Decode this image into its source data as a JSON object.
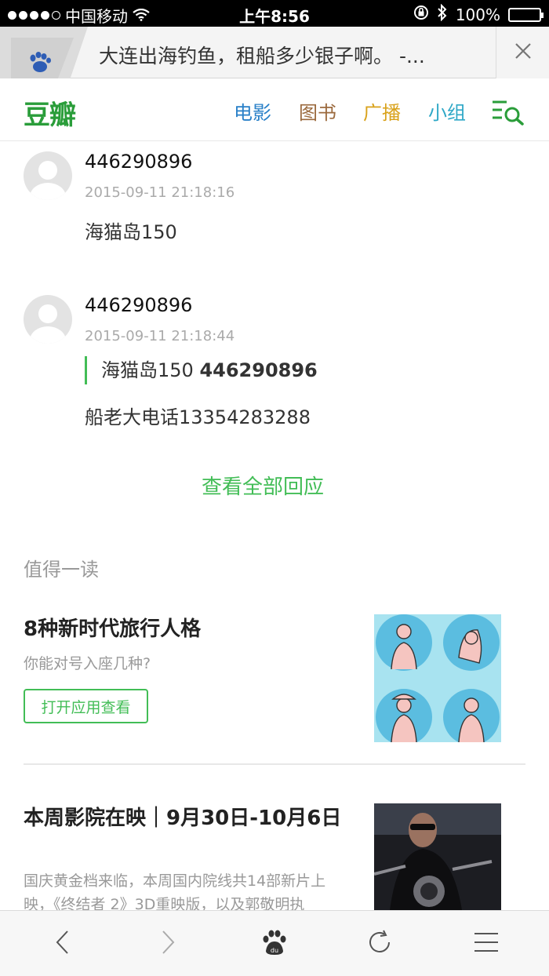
{
  "status_bar": {
    "carrier": "中国移动",
    "time": "上午8:56",
    "battery": "100%",
    "battery_level": 1.0
  },
  "browser_tab": {
    "title": "大连出海钓鱼，租船多少银子啊。 -..."
  },
  "nav": {
    "logo": "豆瓣",
    "links": [
      "电影",
      "图书",
      "广播",
      "小组"
    ]
  },
  "comments": [
    {
      "user": "446290896",
      "time": "2015-09-11 21:18:16",
      "text": "海猫岛150"
    },
    {
      "user": "446290896",
      "time": "2015-09-11 21:18:44",
      "quote_text": "海猫岛150",
      "quote_user": "446290896",
      "text": "船老大电话13354283288"
    }
  ],
  "view_all": "查看全部回应",
  "section_title": "值得一读",
  "articles": [
    {
      "title": "8种新时代旅行人格",
      "subtitle": "你能对号入座几种?",
      "button": "打开应用查看"
    },
    {
      "title": "本周影院在映｜9月30日-10月6日",
      "subtitle": "国庆黄金档来临，本周国内院线共14部新片上映，《终结者 2》3D重映版，以及郭敬明执"
    }
  ],
  "colors": {
    "accent_green": "#42bd56",
    "movie_blue": "#2980c8",
    "book_brown": "#9b6a3e",
    "radio_yellow": "#d9a21b",
    "group_cyan": "#2fa8c7"
  }
}
